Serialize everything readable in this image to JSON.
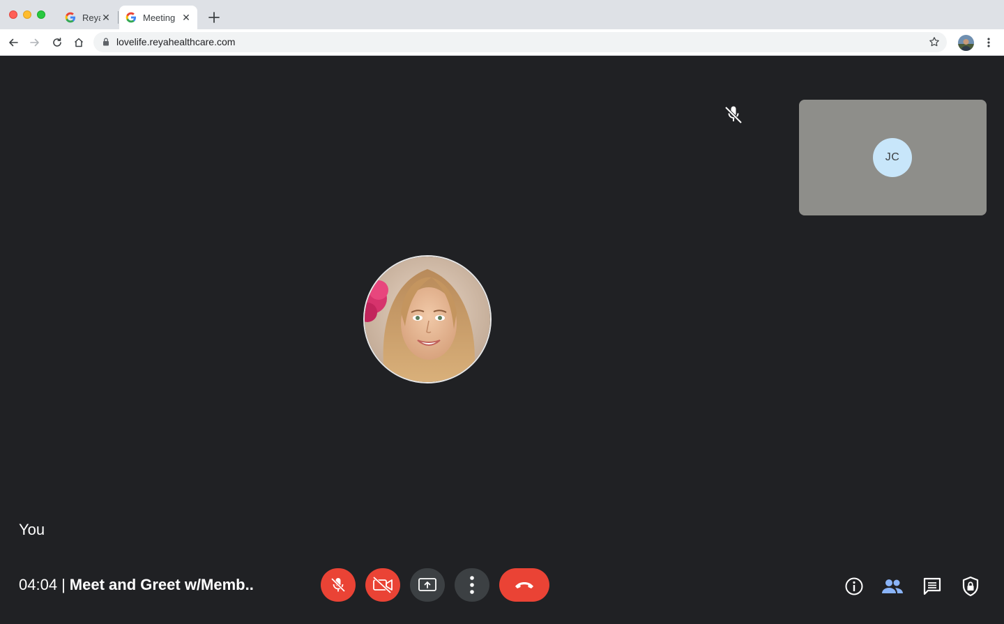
{
  "browser": {
    "tabs": [
      {
        "title": "Reya",
        "favicon": "google-g-icon",
        "active": false
      },
      {
        "title": "Meeting",
        "favicon": "google-g-icon",
        "active": true
      }
    ],
    "tab_close_glyph": "✕",
    "url": "lovelife.reyahealthcare.com"
  },
  "meeting": {
    "self_label": "You",
    "elapsed": "04:04",
    "separator": "|",
    "title": "Meet and Greet w/Memb..",
    "participant": {
      "initials": "JC",
      "muted": true
    }
  },
  "controls": {
    "mic": {
      "icon": "mic-off-icon",
      "state": "off"
    },
    "camera": {
      "icon": "camera-off-icon",
      "state": "off"
    },
    "share": {
      "icon": "present-screen-icon"
    },
    "more": {
      "icon": "more-vertical-icon"
    },
    "hangup": {
      "icon": "phone-hangup-icon"
    }
  },
  "side_actions": [
    {
      "icon": "info-icon"
    },
    {
      "icon": "people-icon"
    },
    {
      "icon": "chat-icon"
    },
    {
      "icon": "shield-lock-icon"
    }
  ],
  "colors": {
    "background": "#202124",
    "danger": "#ea4335",
    "neutral_button": "#3c4043",
    "people_accent": "#8ab4f8",
    "tile": "#8e8e8a",
    "initials_bg": "#c8e6fa"
  }
}
